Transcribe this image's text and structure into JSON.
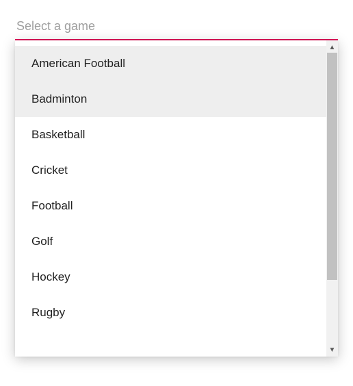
{
  "input": {
    "placeholder": "Select a game",
    "value": ""
  },
  "colors": {
    "accent": "#e3165b"
  },
  "options": [
    {
      "label": "American Football",
      "highlighted": true
    },
    {
      "label": "Badminton",
      "highlighted": true
    },
    {
      "label": "Basketball",
      "highlighted": false
    },
    {
      "label": "Cricket",
      "highlighted": false
    },
    {
      "label": "Football",
      "highlighted": false
    },
    {
      "label": "Golf",
      "highlighted": false
    },
    {
      "label": "Hockey",
      "highlighted": false
    },
    {
      "label": "Rugby",
      "highlighted": false
    }
  ],
  "scroll": {
    "arrow_up": "▲",
    "arrow_down": "▼"
  }
}
